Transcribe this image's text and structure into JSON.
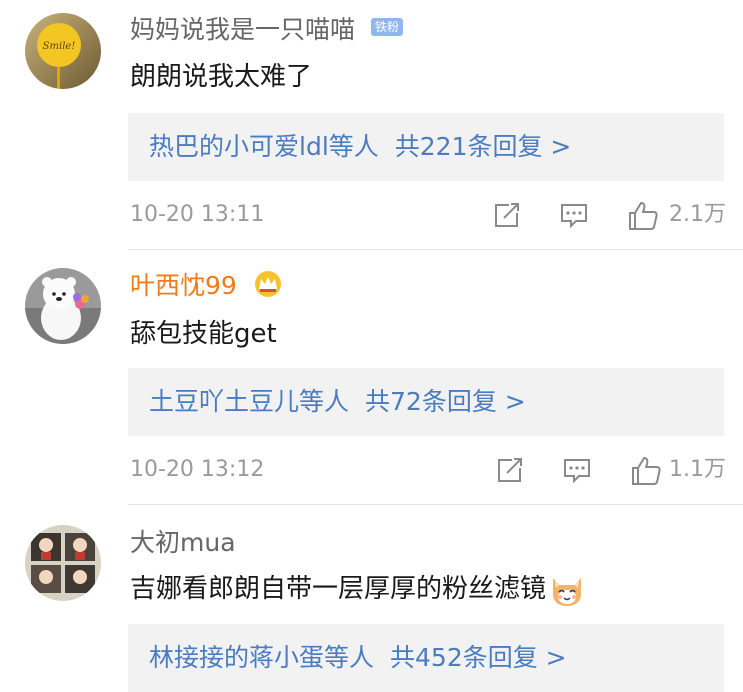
{
  "comments": [
    {
      "username": "妈妈说我是一只喵喵",
      "badge": "铁粉",
      "text": "朗朗说我太难了",
      "reply_users": "热巴的小可爱ldl等人",
      "reply_total": "共221条回复 >",
      "time": "10-20 13:11",
      "likes": "2.1万"
    },
    {
      "username": "叶西忱99",
      "text": "舔包技能get",
      "reply_users": "土豆吖土豆儿等人",
      "reply_total": "共72条回复 >",
      "time": "10-20 13:12",
      "likes": "1.1万"
    },
    {
      "username": "大初mua",
      "text": "吉娜看郎朗自带一层厚厚的粉丝滤镜",
      "reply_users": "林接接的蒋小蛋等人",
      "reply_total": "共452条回复 >"
    }
  ],
  "colors": {
    "username_default": "#666666",
    "username_vip": "#f07c18",
    "link_blue": "#4a7cbf",
    "meta_gray": "#9a9a9a",
    "reply_bg": "#f2f2f2"
  },
  "icons": [
    "share-icon",
    "comment-icon",
    "like-icon",
    "crown-icon",
    "cat-emoji-icon"
  ]
}
